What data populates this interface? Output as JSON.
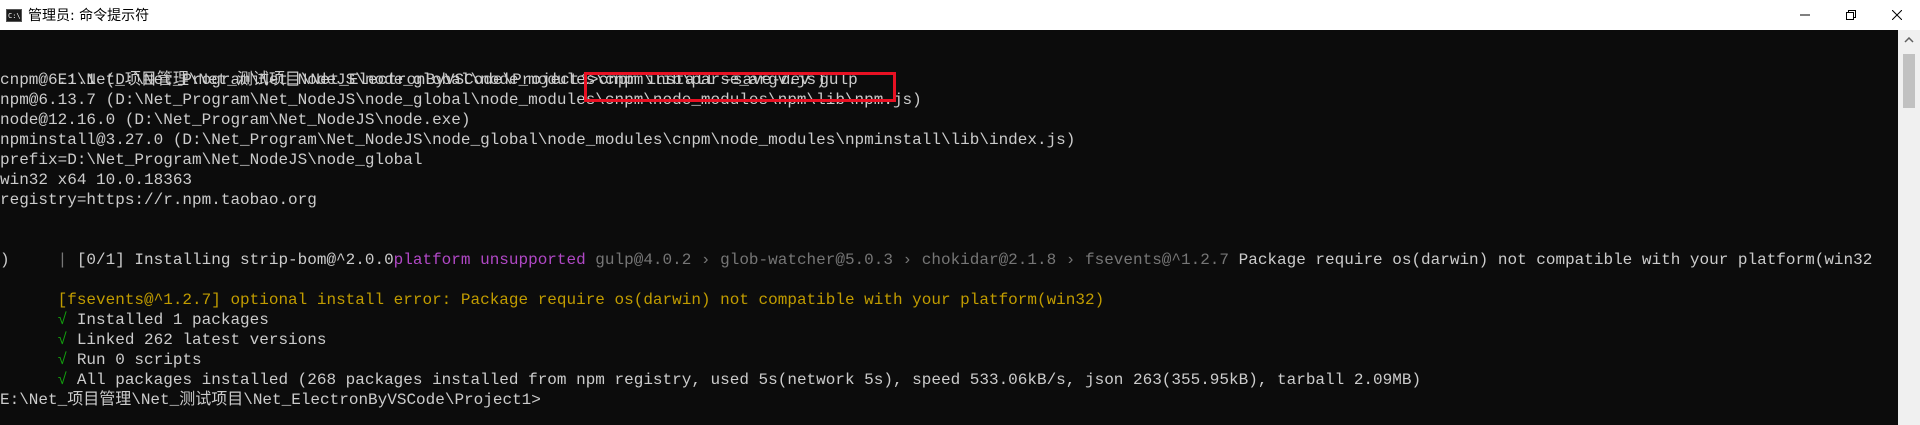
{
  "window": {
    "title": "管理员: 命令提示符",
    "icon": "cmd-icon",
    "icon_text": "C:\\"
  },
  "controls": {
    "minimize": "minimize-icon",
    "maximize": "maximize-icon",
    "close": "close-icon"
  },
  "console": {
    "prompt_line": {
      "prompt": "E:\\Net_项目管理\\Net_测试项目\\Net_ElectronByVSCode\\Project1>",
      "command": "cnpm install -save-dev gulp"
    },
    "info_lines": [
      "cnpm@6.1.1 (D:\\Net_Program\\Net_NodeJS\\node_global\\node_modules\\cnpm\\lib\\parse_argv.js)",
      "npm@6.13.7 (D:\\Net_Program\\Net_NodeJS\\node_global\\node_modules\\cnpm\\node_modules\\npm\\lib\\npm.js)",
      "node@12.16.0 (D:\\Net_Program\\Net_NodeJS\\node.exe)",
      "npminstall@3.27.0 (D:\\Net_Program\\Net_NodeJS\\node_global\\node_modules\\cnpm\\node_modules\\npminstall\\lib\\index.js)",
      "prefix=D:\\Net_Program\\Net_NodeJS\\node_global",
      "win32 x64 10.0.18363",
      "registry=https://r.npm.taobao.org"
    ],
    "install_line": {
      "prefix": "| ",
      "progress": "[0/1] Installing strip-bom@^2.0.0",
      "platform": "platform unsupported",
      "chain": " gulp@4.0.2 › glob-watcher@5.0.3 › chokidar@2.1.8 › fsevents@^1.2.7",
      "message": " Package require os(darwin) not compatible with your platform(win32",
      "wrap": ")"
    },
    "error_line": {
      "tag": "[fsevents@^1.2.7]",
      "text": " optional install error: Package require os(darwin) not compatible with your platform(win32)"
    },
    "success_lines": [
      {
        "check": "√",
        "text": " Installed 1 packages"
      },
      {
        "check": "√",
        "text": " Linked 262 latest versions"
      },
      {
        "check": "√",
        "text": " Run 0 scripts"
      },
      {
        "check": "√",
        "text": " All packages installed (268 packages installed from npm registry, used 5s(network 5s), speed 533.06kB/s, json 263(355.95kB), tarball 2.09MB)"
      }
    ],
    "final_prompt": "E:\\Net_项目管理\\Net_测试项目\\Net_ElectronByVSCode\\Project1>"
  },
  "colors": {
    "background": "#0c0c0c",
    "text": "#cccccc",
    "highlight": "#e81123",
    "success": "#13a10e",
    "warning": "#c19c00",
    "platform": "#b148c6",
    "dim": "#767676"
  }
}
